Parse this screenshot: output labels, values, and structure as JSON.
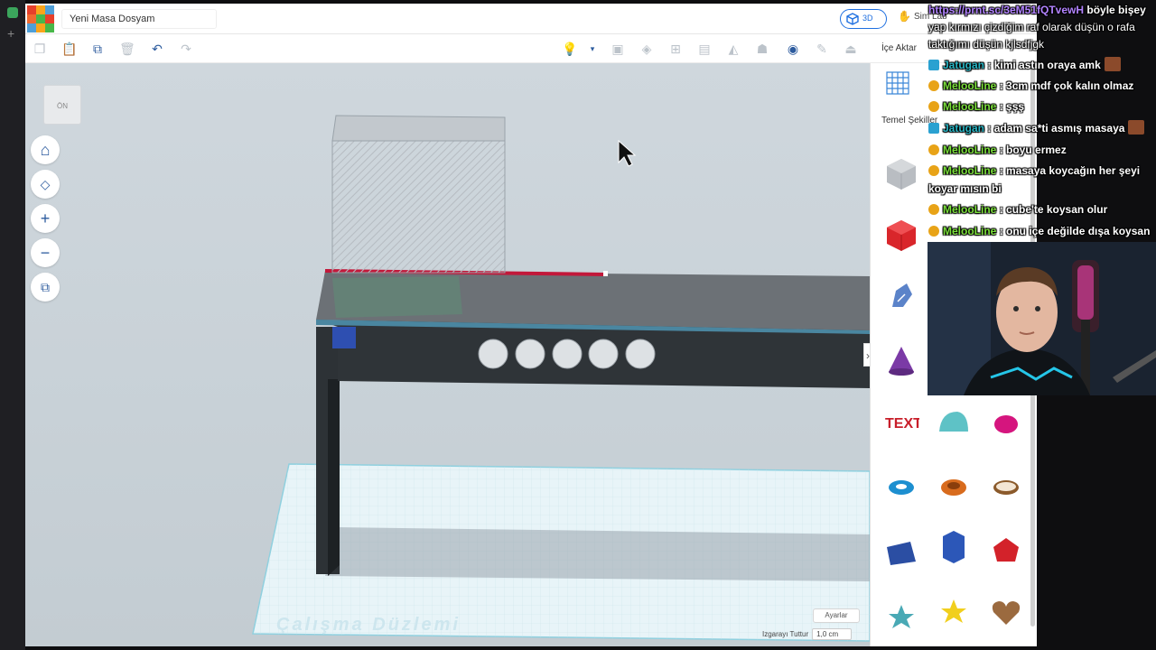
{
  "app": {
    "project_title": "Yeni Masa Dosyam",
    "logo_letters": [
      "TIN",
      "KER",
      "CAD"
    ],
    "view_mode_label": "3D",
    "sim_lab_label": "Sim Lab",
    "import_label": "İçe Aktar"
  },
  "viewport": {
    "view_cube_label": "ÖN",
    "controls": [
      {
        "name": "home-view-button",
        "glyph": "⌂"
      },
      {
        "name": "fit-view-button",
        "glyph": "◇"
      },
      {
        "name": "zoom-in-button",
        "glyph": "+"
      },
      {
        "name": "zoom-out-button",
        "glyph": "−"
      },
      {
        "name": "perspective-button",
        "glyph": "⧉"
      }
    ],
    "workplane_label": "Çalışma Düzlemi",
    "settings_label": "Ayarlar",
    "snap_grid_label": "Izgarayı Tuttur",
    "snap_grid_value": "1,0 cm"
  },
  "shapes_panel": {
    "category_label": "Temel Şekiller",
    "colors": {
      "box_grey": "#b9bdc2",
      "box_red": "#d9262b",
      "scribble_blue": "#5b83c9",
      "cone_purple": "#7b3aa6",
      "text_red": "#c81e2a",
      "halfsphere_teal": "#5ec2c6",
      "pink": "#d5157e",
      "torus_blue": "#1d8fd0",
      "tube_orange": "#d86b1d",
      "ring_brown": "#8b5a2b",
      "wedge_blue": "#2b4ea3",
      "hex_blue": "#2c57b8",
      "ico_red": "#d3222a",
      "star_teal": "#49a9b5",
      "star_yellow": "#f1cf1d",
      "heart_brown": "#9b6a3f"
    }
  },
  "chat": {
    "messages": [
      {
        "user": "https://prnt.sc/3eM51fQTvewH",
        "text": "böyle bişey yap kırmızı çizdiğim raf olarak düşün o rafa taktığımı düşün kjlsdfjgk",
        "user_color": "#b283ff"
      },
      {
        "user": "Jatugan",
        "text": ": kimi astın oraya amk",
        "user_color": "#27b5c4"
      },
      {
        "user": "MelooLine",
        "text": ": 3cm mdf çok kalın olmaz",
        "user_color": "#7be03b"
      },
      {
        "user": "MelooLine",
        "text": ": şşş",
        "user_color": "#7be03b"
      },
      {
        "user": "Jatugan",
        "text": ": adam sa*ti asmış masaya",
        "user_color": "#27b5c4"
      },
      {
        "user": "MelooLine",
        "text": ": boyu ermez",
        "user_color": "#7be03b"
      },
      {
        "user": "MelooLine",
        "text": ": masaya koycağın her şeyi koyar mısın bi",
        "user_color": "#7be03b"
      },
      {
        "user": "MelooLine",
        "text": ": cube'te koysan olur",
        "user_color": "#7be03b"
      },
      {
        "user": "MelooLine",
        "text": ": onu içe değilde dışa koysan",
        "user_color": "#7be03b"
      }
    ]
  }
}
